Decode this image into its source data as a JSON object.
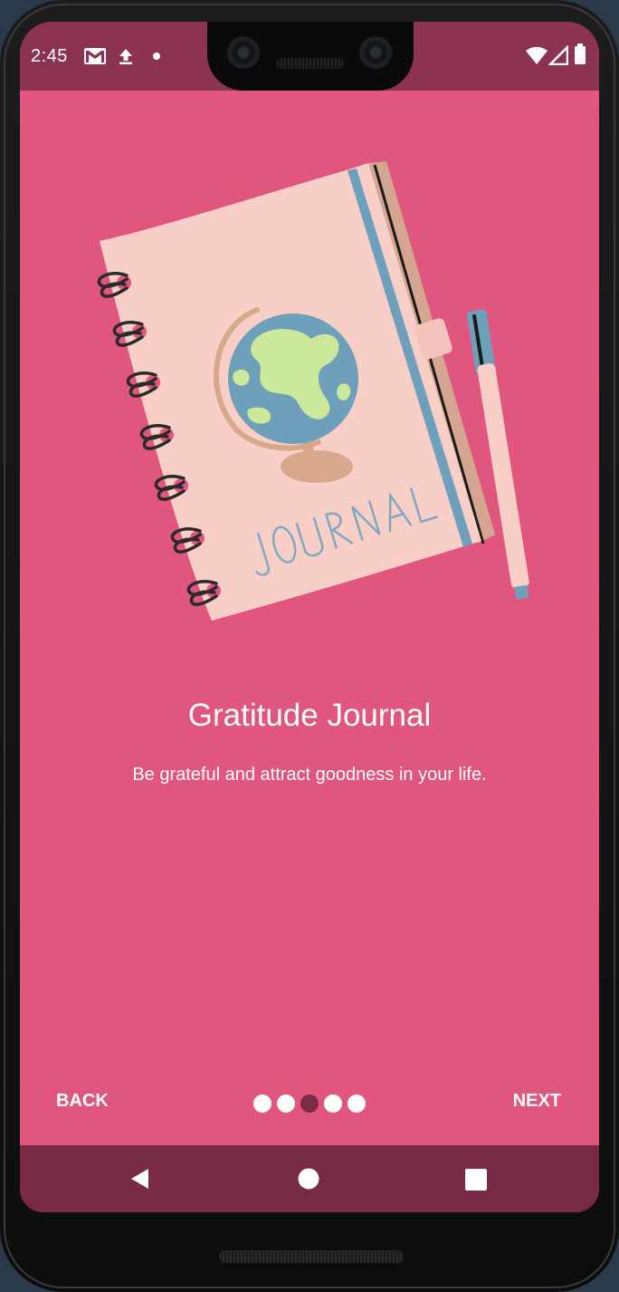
{
  "status_bar": {
    "time": "2:45",
    "left_icons": [
      "gmail-icon",
      "upload-icon",
      "dot-icon"
    ],
    "right_icons": [
      "wifi-icon",
      "signal-icon",
      "battery-icon"
    ]
  },
  "onboarding": {
    "illustration": "journal-notebook-with-globe-and-pen",
    "title": "Gratitude Journal",
    "subtitle": "Be grateful and attract goodness in your life.",
    "back_label": "BACK",
    "next_label": "NEXT",
    "pager": {
      "total": 5,
      "current": 3
    }
  },
  "navigation_bar": {
    "buttons": [
      "back-triangle-icon",
      "home-circle-icon",
      "recents-square-icon"
    ]
  },
  "colors": {
    "background": "#e0567f",
    "status_bar": "#8b3350",
    "navigation_bar": "#782a44",
    "active_dot": "#7a2b45",
    "text": "#ffffff"
  }
}
